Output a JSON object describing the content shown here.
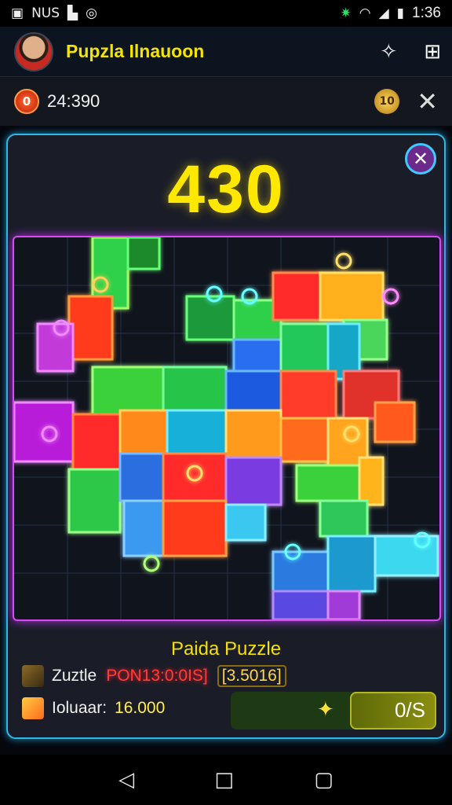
{
  "status_bar": {
    "left_text": "NUS",
    "time": "1:36"
  },
  "app_bar": {
    "title": "Pupzla Ilnauoon"
  },
  "info_row": {
    "coin_badge": "0",
    "score": "24:390",
    "gold_badge": "10"
  },
  "game": {
    "big_score": "430",
    "puzzle_name": "Paida Puzzle",
    "row1": {
      "label": "Zuztle",
      "value_red": "PON13:0:0IS]",
      "value_gold": "[3.5016]"
    },
    "row2": {
      "label": "Ioluaar:",
      "value": "16.000",
      "progress_label": "0/S",
      "progress": 0.42
    }
  },
  "colors": {
    "accent_yellow": "#ffe800",
    "panel_border": "#2fb8e6",
    "board_border": "#d54cf0"
  }
}
